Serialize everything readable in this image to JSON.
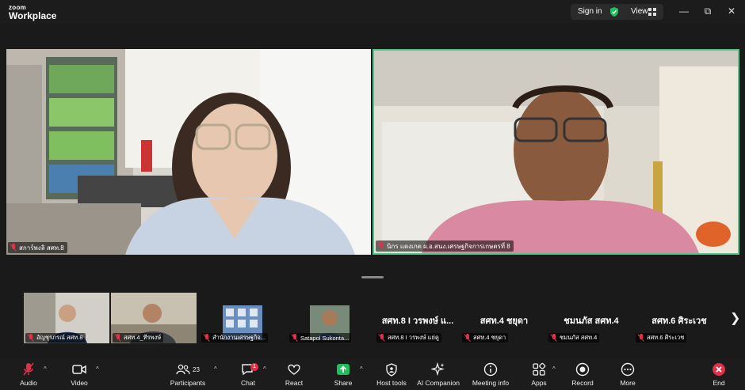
{
  "app": {
    "brand_small": "zoom",
    "brand_large": "Workplace"
  },
  "titlebar": {
    "signin_label": "Sign in",
    "view_label": "View"
  },
  "videos": [
    {
      "name": "สการ์พงลิ สศท.8"
    },
    {
      "name": "นิกร แดงเกต ผ.อ.สนง.เศรษฐกิจการเกษตรที่ 8"
    }
  ],
  "thumbnails": [
    {
      "name": "อัญชุรภรณ์ สศท.8"
    },
    {
      "name": "สศท.4_ทีรพงษ์"
    },
    {
      "name": "สำนักงานเศรษฐกิจ..."
    },
    {
      "name": "Satapol Sukonta..."
    },
    {
      "title": "สศท.8 I วรพงษ์ แ...",
      "name": "สศท.8 I วรพงษ์ แย่คู"
    },
    {
      "title": "สศท.4 ชยุดา",
      "name": "สศท.4 ชยุดา"
    },
    {
      "title": "ชมนภัส สศท.4",
      "name": "ชมนภัส สศท.4"
    },
    {
      "title": "สศท.6 ศิระเวช",
      "name": "สศท.6 ศิระเวช"
    }
  ],
  "toolbar": {
    "audio": "Audio",
    "video": "Video",
    "participants": "Participants",
    "participants_count": "23",
    "chat": "Chat",
    "chat_badge": "1",
    "react": "React",
    "share": "Share",
    "host_tools": "Host tools",
    "ai_companion": "AI Companion",
    "meeting_info": "Meeting info",
    "apps": "Apps",
    "record": "Record",
    "more": "More",
    "end": "End"
  },
  "colors": {
    "active_speaker": "#4cc88d",
    "mute_red": "#e0314b",
    "share_green": "#1fbf5b",
    "end_red": "#e0314b"
  }
}
